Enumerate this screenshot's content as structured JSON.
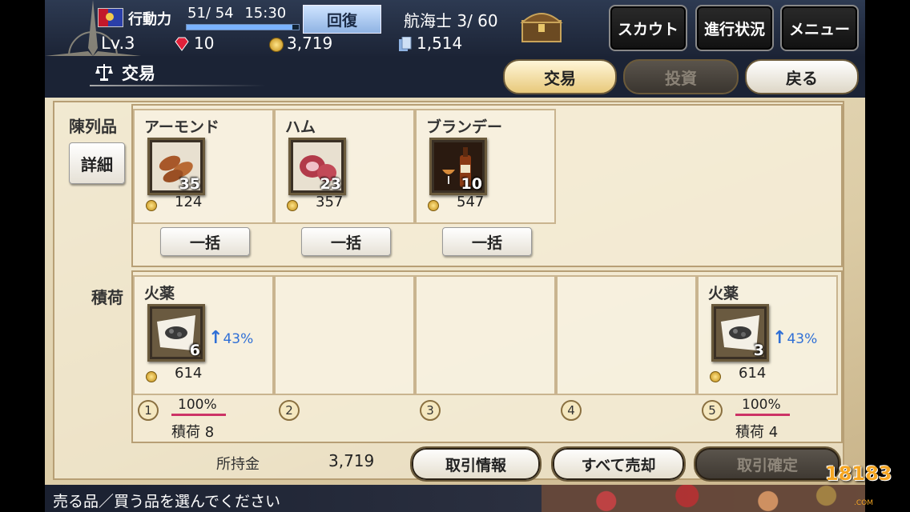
{
  "status": {
    "action_label": "行動力",
    "action_value": "51/ 54",
    "clock": "15:30",
    "action_fraction": 0.944,
    "recover_label": "回復",
    "navigator": "航海士 3/ 60",
    "level": "Lv.3",
    "gems": "10",
    "coins": "3,719",
    "pages": "1,514",
    "scout_label": "スカウト",
    "progress_label": "進行状況",
    "menu_label": "メニュー"
  },
  "header": {
    "title": "交易",
    "tabs": {
      "trade": "交易",
      "invest": "投資",
      "back": "戻る"
    }
  },
  "display": {
    "label": "陳列品",
    "detail_label": "詳細",
    "bulk_label": "一括",
    "items": [
      {
        "name": "アーモンド",
        "qty": "35",
        "price": "124",
        "icon": "almond-icon"
      },
      {
        "name": "ハム",
        "qty": "23",
        "price": "357",
        "icon": "ham-icon"
      },
      {
        "name": "ブランデー",
        "qty": "10",
        "price": "547",
        "icon": "brandy-icon"
      }
    ]
  },
  "cargo": {
    "label": "積荷",
    "slots": [
      {
        "num": "1",
        "name": "火薬",
        "qty": "6",
        "price": "614",
        "rate": "43%",
        "load_pct": "100%",
        "load": "積荷 8"
      },
      {
        "num": "2"
      },
      {
        "num": "3"
      },
      {
        "num": "4"
      },
      {
        "num": "5",
        "name": "火薬",
        "qty": "3",
        "price": "614",
        "rate": "43%",
        "load_pct": "100%",
        "load": "積荷 4"
      }
    ]
  },
  "money": {
    "label": "所持金",
    "value": "3,719"
  },
  "actions": {
    "info": "取引情報",
    "sell_all": "すべて売却",
    "confirm": "取引確定"
  },
  "footer": {
    "message": "売る品／買う品を選んでください"
  },
  "watermark": {
    "logo": "18183",
    "sub": ".COM"
  }
}
